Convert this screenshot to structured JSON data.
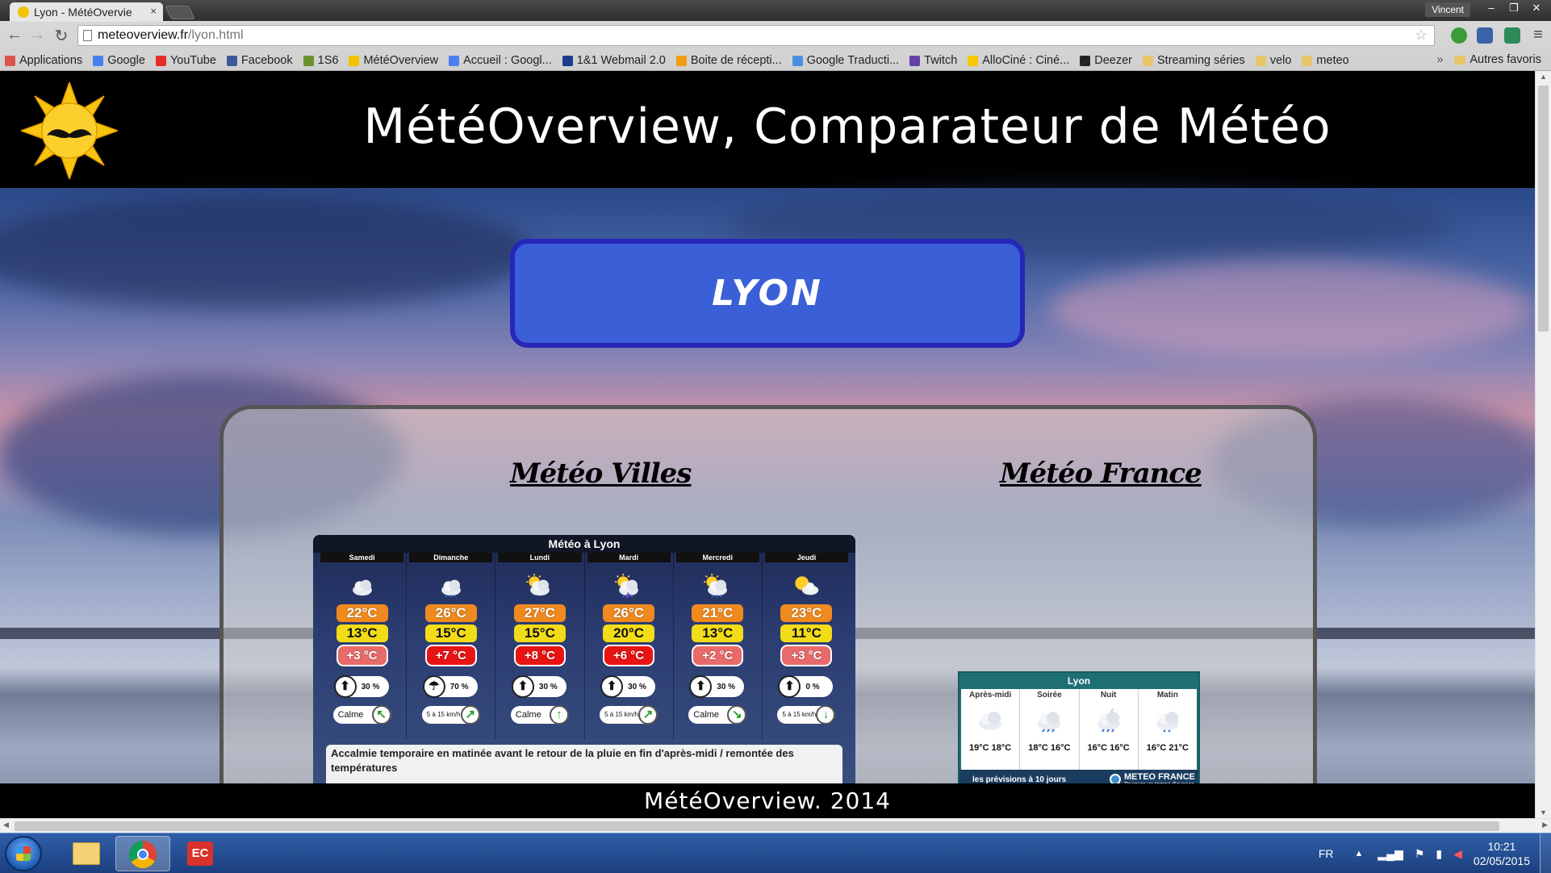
{
  "browser": {
    "tab_title": "Lyon - MétéOvervie",
    "tab_close": "×",
    "user": "Vincent",
    "window_buttons": [
      "‒",
      "❐",
      "✕"
    ],
    "url_host": "meteoverview.fr",
    "url_path": "/lyon.html",
    "bookmarks": [
      {
        "label": "Applications",
        "color": "#d9534f"
      },
      {
        "label": "Google",
        "color": "#4a7ff0"
      },
      {
        "label": "YouTube",
        "color": "#e52d27"
      },
      {
        "label": "Facebook",
        "color": "#3b5998"
      },
      {
        "label": "1S6",
        "color": "#6a8f2e"
      },
      {
        "label": "MétéOverview",
        "color": "#f3c200"
      },
      {
        "label": "Accueil : Googl...",
        "color": "#4a7ff0"
      },
      {
        "label": "1&1 Webmail 2.0",
        "color": "#1c3c8c"
      },
      {
        "label": "Boite de récepti...",
        "color": "#f39c12"
      },
      {
        "label": "Google Traducti...",
        "color": "#4a90e2"
      },
      {
        "label": "Twitch",
        "color": "#6441a5"
      },
      {
        "label": "AlloCiné : Ciné...",
        "color": "#f7c800"
      },
      {
        "label": "Deezer",
        "color": "#222222"
      },
      {
        "label": "Streaming séries",
        "color": "#e8c66a"
      },
      {
        "label": "velo",
        "color": "#e8c66a"
      },
      {
        "label": "meteo",
        "color": "#e8c66a"
      }
    ],
    "bookmarks_overflow": "»",
    "other_bookmarks": "Autres favoris"
  },
  "site": {
    "title": "MétéOverview, Comparateur de Météo",
    "city": "LYON",
    "heading_left": "Météo Villes",
    "heading_right": "Météo France",
    "footer": "MétéOverview. 2014"
  },
  "widget": {
    "title": "Météo à Lyon",
    "days": [
      {
        "name": "Samedi",
        "icon": "cloudy-icon",
        "max": "22°C",
        "min": "13°C",
        "delta": "+3 °C",
        "delta_color": "#e86a6a",
        "rain": "30 %",
        "umbrella": "closed",
        "wind": "Calme",
        "wind_small": "",
        "wind_arrow": "↖"
      },
      {
        "name": "Dimanche",
        "icon": "cloud-rain-icon",
        "max": "26°C",
        "min": "15°C",
        "delta": "+7 °C",
        "delta_color": "#e81414",
        "rain": "70 %",
        "umbrella": "open",
        "wind": "",
        "wind_small": "5 à 15 km/h",
        "wind_arrow": "↗"
      },
      {
        "name": "Lundi",
        "icon": "sun-cloud-icon",
        "max": "27°C",
        "min": "15°C",
        "delta": "+8 °C",
        "delta_color": "#e81414",
        "rain": "30 %",
        "umbrella": "closed",
        "wind": "Calme",
        "wind_small": "",
        "wind_arrow": "↑"
      },
      {
        "name": "Mardi",
        "icon": "storm-icon",
        "max": "26°C",
        "min": "20°C",
        "delta": "+6 °C",
        "delta_color": "#e81414",
        "rain": "30 %",
        "umbrella": "closed",
        "wind": "",
        "wind_small": "5 à 15 km/h",
        "wind_arrow": "↗"
      },
      {
        "name": "Mercredi",
        "icon": "sun-cloud-rain-icon",
        "max": "21°C",
        "min": "13°C",
        "delta": "+2 °C",
        "delta_color": "#e86a6a",
        "rain": "30 %",
        "umbrella": "closed",
        "wind": "Calme",
        "wind_small": "",
        "wind_arrow": "↘"
      },
      {
        "name": "Jeudi",
        "icon": "sunny-cloud-icon",
        "max": "23°C",
        "min": "11°C",
        "delta": "+3 °C",
        "delta_color": "#e86a6a",
        "rain": "0 %",
        "umbrella": "closed",
        "wind": "",
        "wind_small": "5 à 15 km/h",
        "wind_arrow": "↓"
      }
    ],
    "description": "Accalmie temporaire en matinée avant le retour de la pluie en fin d'après-midi / remontée des températures"
  },
  "meteofrance": {
    "title": "Lyon",
    "periods": [
      {
        "label": "Après-midi",
        "temps": "19°C  18°C",
        "icon": "cloudy-icon"
      },
      {
        "label": "Soirée",
        "temps": "18°C  16°C",
        "icon": "cloud-rain-icon"
      },
      {
        "label": "Nuit",
        "temps": "16°C  16°C",
        "icon": "moon-cloud-rain-icon"
      },
      {
        "label": "Matin",
        "temps": "16°C  21°C",
        "icon": "cloud-drizzle-icon"
      }
    ],
    "link": "les prévisions à 10 jours",
    "brand": "METEO FRANCE",
    "slogan": "Toujours un temps d'avance"
  },
  "taskbar": {
    "language": "FR",
    "time": "10:21",
    "date": "02/05/2015"
  }
}
